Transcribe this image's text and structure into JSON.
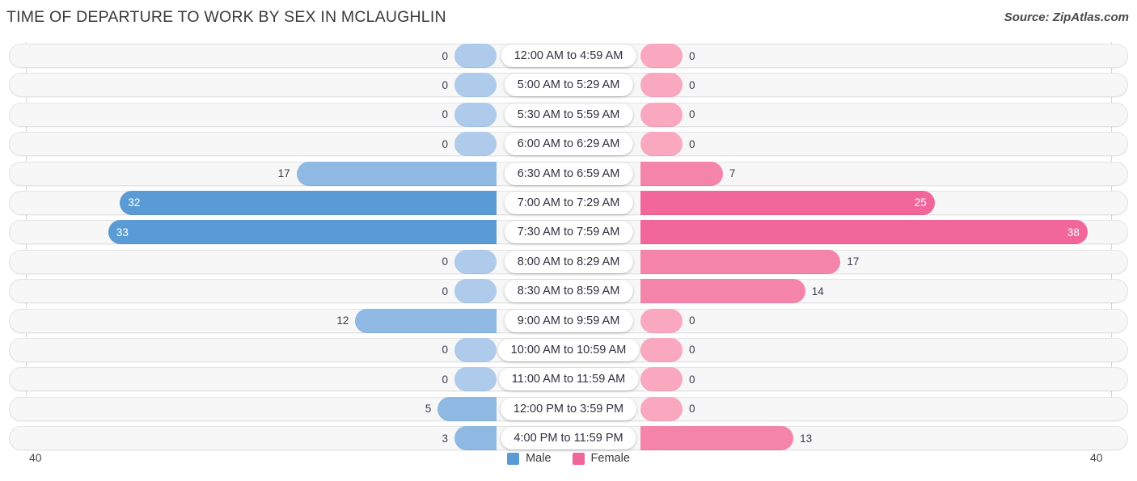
{
  "header": {
    "title": "TIME OF DEPARTURE TO WORK BY SEX IN MCLAUGHLIN",
    "source": "Source: ZipAtlas.com"
  },
  "legend": {
    "male_label": "Male",
    "female_label": "Female",
    "male_color": "#5b9bd5",
    "female_color": "#f0659a"
  },
  "axis": {
    "left_tick": "40",
    "right_tick": "40",
    "max": 40
  },
  "colors": {
    "male_strong": "#5b9bd5",
    "male_light": "#aecbec",
    "female_strong": "#f2679b",
    "female_light": "#f9a8c0",
    "track_bg": "#f7f7f7",
    "track_border": "#e3e3e3"
  },
  "chart_data": {
    "type": "bar",
    "title": "TIME OF DEPARTURE TO WORK BY SEX IN MCLAUGHLIN",
    "subtitle": "Source: ZipAtlas.com",
    "orientation": "horizontal-diverging",
    "xlabel": "",
    "ylabel": "",
    "xlim": [
      40,
      40
    ],
    "grid": false,
    "legend_position": "bottom-center",
    "categories": [
      "12:00 AM to 4:59 AM",
      "5:00 AM to 5:29 AM",
      "5:30 AM to 5:59 AM",
      "6:00 AM to 6:29 AM",
      "6:30 AM to 6:59 AM",
      "7:00 AM to 7:29 AM",
      "7:30 AM to 7:59 AM",
      "8:00 AM to 8:29 AM",
      "8:30 AM to 8:59 AM",
      "9:00 AM to 9:59 AM",
      "10:00 AM to 10:59 AM",
      "11:00 AM to 11:59 AM",
      "12:00 PM to 3:59 PM",
      "4:00 PM to 11:59 PM"
    ],
    "series": [
      {
        "name": "Male",
        "side": "left",
        "color": "#5b9bd5",
        "values": [
          0,
          0,
          0,
          0,
          17,
          32,
          33,
          0,
          0,
          12,
          0,
          0,
          5,
          3
        ]
      },
      {
        "name": "Female",
        "side": "right",
        "color": "#f0659a",
        "values": [
          0,
          0,
          0,
          0,
          7,
          25,
          38,
          17,
          14,
          0,
          0,
          0,
          0,
          13
        ]
      }
    ]
  }
}
